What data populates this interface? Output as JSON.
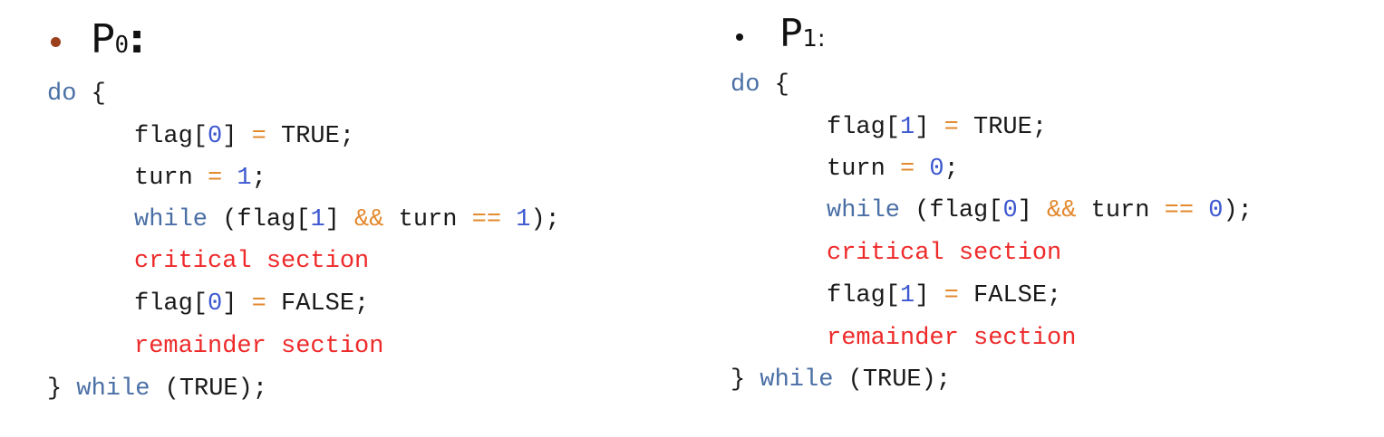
{
  "p0": {
    "heading": {
      "letter": "P",
      "subscript": "0",
      "colon": ":"
    },
    "do_keyword": "do",
    "open_brace": "{",
    "line1": {
      "var": "flag[",
      "idx": "0",
      "close": "]",
      "eq": "=",
      "val": "TRUE;"
    },
    "line2": {
      "var": "turn",
      "eq": "=",
      "num": "1",
      "semi": ";"
    },
    "line3": {
      "kw": "while",
      "open": "(flag[",
      "idx": "1",
      "close": "]",
      "and": "&&",
      "var": "turn",
      "cmp": "==",
      "num": "1",
      "end": ");"
    },
    "line4": {
      "text": "critical section"
    },
    "line5": {
      "var": "flag[",
      "idx": "0",
      "close": "]",
      "eq": "=",
      "val": "FALSE;"
    },
    "line6": {
      "text": "remainder section"
    },
    "close": {
      "brace": "}",
      "kw": "while",
      "rest": "(TRUE);"
    }
  },
  "p1": {
    "heading": {
      "letter": "P",
      "subscript": "1",
      "colon": ":"
    },
    "do_keyword": "do",
    "open_brace": "{",
    "line1": {
      "var": "flag[",
      "idx": "1",
      "close": "]",
      "eq": "=",
      "val": "TRUE;"
    },
    "line2": {
      "var": "turn",
      "eq": "=",
      "num": "0",
      "semi": ";"
    },
    "line3": {
      "kw": "while",
      "open": "(flag[",
      "idx": "0",
      "close": "]",
      "and": "&&",
      "var": "turn",
      "cmp": "==",
      "num": "0",
      "end": ");"
    },
    "line4": {
      "text": "critical section"
    },
    "line5": {
      "var": "flag[",
      "idx": "1",
      "close": "]",
      "eq": "=",
      "val": "FALSE;"
    },
    "line6": {
      "text": "remainder section"
    },
    "close": {
      "brace": "}",
      "kw": "while",
      "rest": "(TRUE);"
    }
  },
  "colors": {
    "keyword": "#4a6fa5",
    "number": "#3c57d0",
    "operator": "#e3892e",
    "text": "#1a1a1a",
    "section": "#ee2a2a",
    "bullet_left": "#9c3f1c",
    "bullet_right": "#111111"
  }
}
